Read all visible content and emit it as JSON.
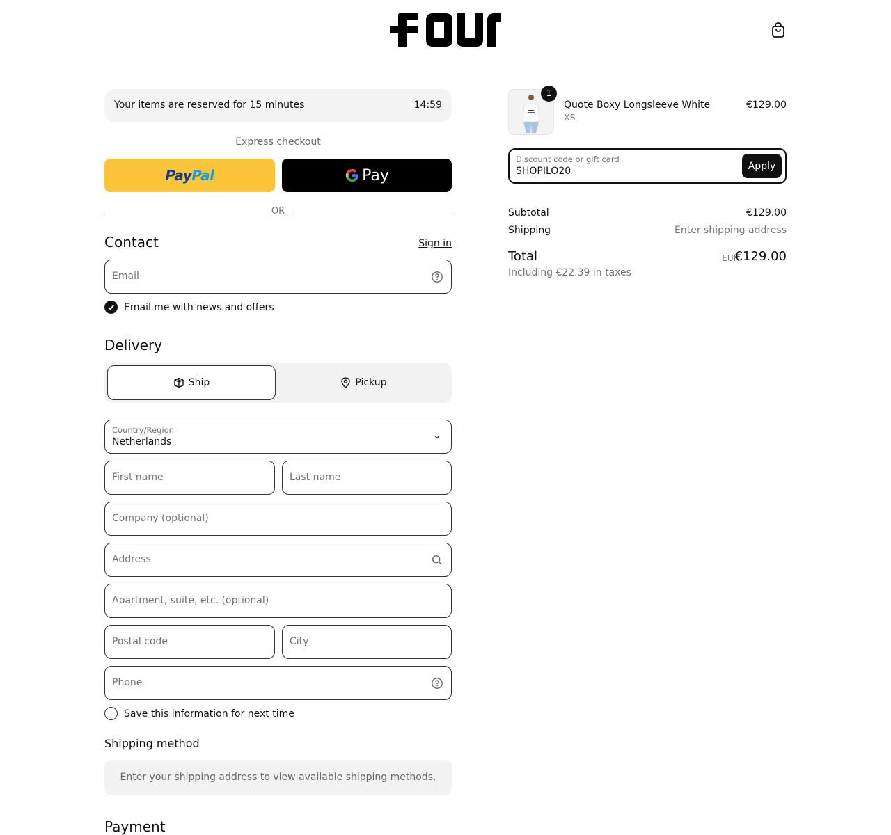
{
  "header": {
    "logo_text": "FOUR"
  },
  "reservation": {
    "text": "Your items are reserved for 15 minutes",
    "timer": "14:59"
  },
  "express": {
    "label": "Express checkout",
    "paypal_part1": "Pay",
    "paypal_part2": "Pal",
    "gpay_text": "Pay",
    "or_text": "OR"
  },
  "contact": {
    "title": "Contact",
    "signin_label": "Sign in",
    "email_placeholder": "Email",
    "newsletter_label": "Email me with news and offers",
    "newsletter_checked": true
  },
  "delivery": {
    "title": "Delivery",
    "options": [
      {
        "label": "Ship",
        "selected": true
      },
      {
        "label": "Pickup",
        "selected": false
      }
    ],
    "country_label": "Country/Region",
    "country_value": "Netherlands",
    "first_name_placeholder": "First name",
    "last_name_placeholder": "Last name",
    "company_placeholder": "Company (optional)",
    "address_placeholder": "Address",
    "apartment_placeholder": "Apartment, suite, etc. (optional)",
    "postal_placeholder": "Postal code",
    "city_placeholder": "City",
    "phone_placeholder": "Phone",
    "save_info_label": "Save this information for next time",
    "save_info_checked": false
  },
  "shipping_method": {
    "title": "Shipping method",
    "info": "Enter your shipping address to view available shipping methods."
  },
  "payment": {
    "title": "Payment"
  },
  "order": {
    "item": {
      "name": "Quote Boxy Longsleeve White",
      "variant": "XS",
      "price": "€129.00",
      "quantity": "1"
    },
    "discount_label": "Discount code or gift card",
    "discount_value": "SHOPILO20",
    "apply_label": "Apply",
    "subtotal_label": "Subtotal",
    "subtotal_value": "€129.00",
    "shipping_label": "Shipping",
    "shipping_value": "Enter shipping address",
    "total_label": "Total",
    "currency": "EUR",
    "total_value": "€129.00",
    "tax_note": "Including €22.39 in taxes"
  },
  "colors": {
    "paypal_yellow": "#fcc439",
    "gpay_black": "#000000",
    "text": "#111111",
    "muted": "#707070",
    "panel_bg": "#f2f2f2"
  }
}
